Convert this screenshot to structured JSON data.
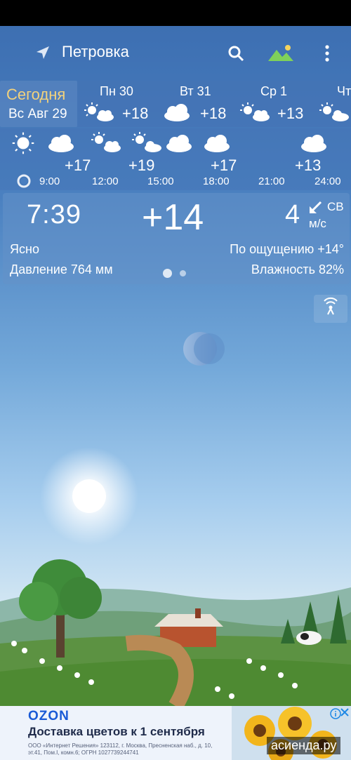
{
  "header": {
    "city": "Петровка"
  },
  "today": {
    "label": "Сегодня",
    "date": "Вс Авг 29"
  },
  "days": [
    {
      "name": "Пн 30",
      "temp": "+18",
      "icon": "sun-cloud-icon"
    },
    {
      "name": "Вт 31",
      "temp": "+18",
      "icon": "cloud-icon"
    },
    {
      "name": "Ср 1",
      "temp": "+13",
      "icon": "sun-cloud-icon"
    },
    {
      "name": "Чт",
      "temp": "",
      "icon": "sun-cloud-icon"
    }
  ],
  "hourly": [
    {
      "time": "9:00",
      "temp": "+17",
      "icon": "sun-icon"
    },
    {
      "time": "12:00",
      "temp": "+19",
      "icon": "cloud-icon"
    },
    {
      "time": "15:00",
      "temp": "+17",
      "icon": "sun-cloud-icon"
    },
    {
      "time": "18:00",
      "temp": "+13",
      "icon": "sun-cloud-icon"
    },
    {
      "time": "21:00",
      "temp": "",
      "icon": "cloud-icon"
    },
    {
      "time": "24:00",
      "temp": "",
      "icon": "cloud-icon"
    }
  ],
  "current": {
    "time": "7:39",
    "temp": "+14",
    "wind_speed": "4",
    "wind_dir": "СВ",
    "wind_unit": "м/с",
    "condition": "Ясно",
    "feels_like": "По ощущению +14°",
    "pressure": "Давление 764 мм",
    "humidity": "Влажность 82%"
  },
  "ad": {
    "brand": "OZON",
    "title": "Доставка цветов к 1 сентября",
    "fine_print": "ООО «Интернет Решения» 123112, г. Москва, Пресненская наб., д. 10, эт.41, Пом.I, комн.6; ОГРН 1027739244741"
  },
  "watermark": "асиенда.ру",
  "colors": {
    "today_label": "#f3d27c",
    "ad_brand": "#1a5ad6"
  }
}
